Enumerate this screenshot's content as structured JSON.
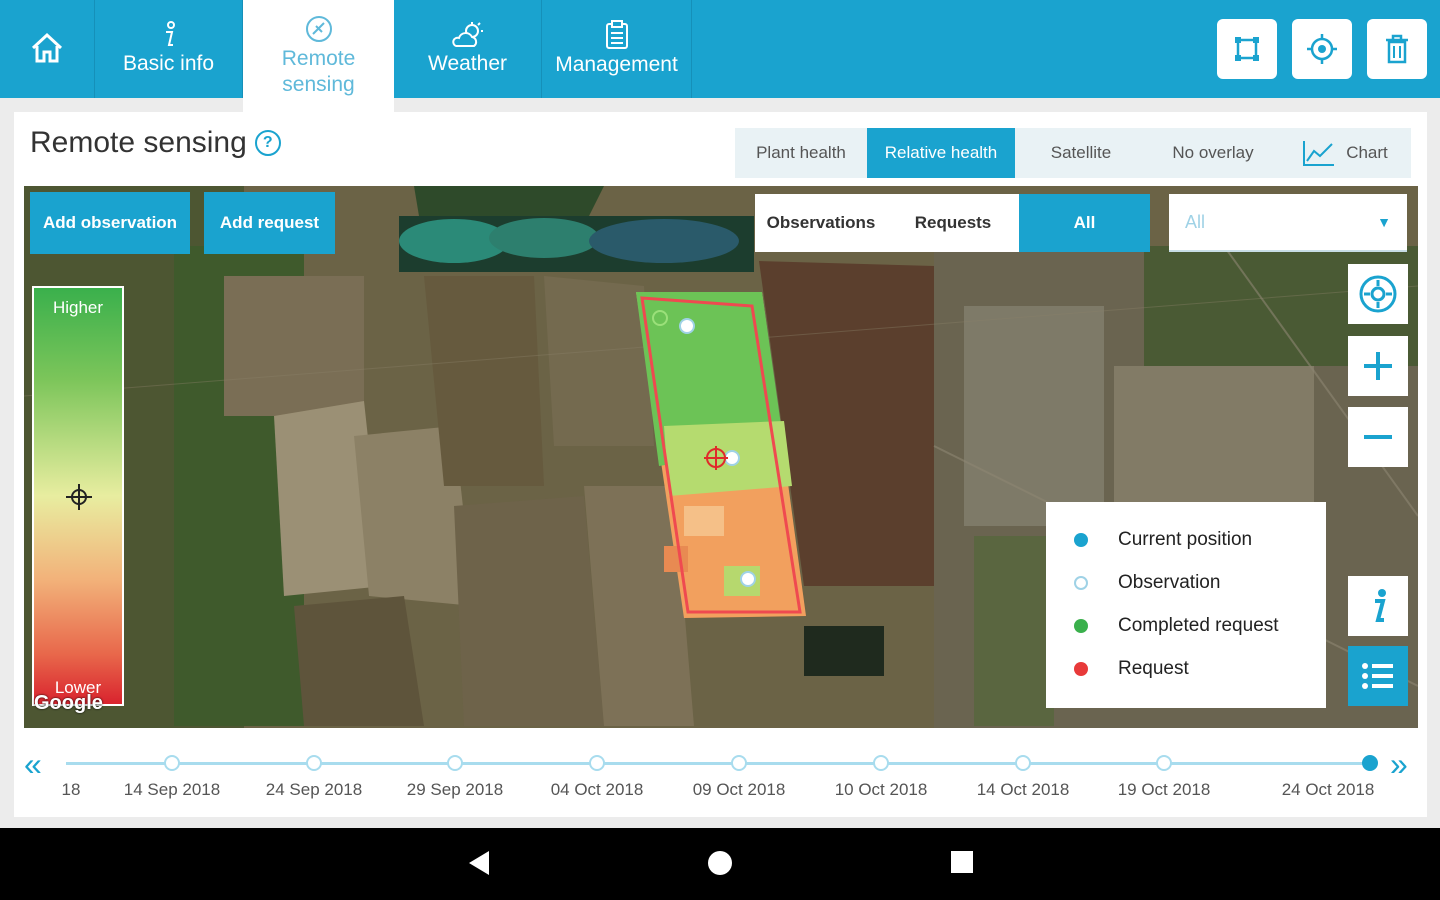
{
  "nav": {
    "tabs": [
      {
        "label": "Basic info",
        "icon": "info-icon"
      },
      {
        "label": "Remote\nsensing",
        "icon": "satellite-icon"
      },
      {
        "label": "Weather",
        "icon": "weather-icon"
      },
      {
        "label": "Management",
        "icon": "clipboard-icon"
      }
    ],
    "home_icon": "home-icon",
    "actions": [
      "draw-area-icon",
      "locate-icon",
      "delete-icon"
    ],
    "accent": "#1aa3cf"
  },
  "page": {
    "title": "Remote sensing",
    "help_symbol": "?"
  },
  "overlay_tabs": {
    "items": [
      "Plant health",
      "Relative health",
      "Satellite",
      "No overlay",
      "Chart"
    ],
    "active": "Relative health"
  },
  "map": {
    "add_observation": "Add observation",
    "add_request": "Add request",
    "filter_tabs": [
      "Observations",
      "Requests",
      "All"
    ],
    "filter_active": "All",
    "select_value": "All",
    "scale_high": "Higher",
    "scale_low": "Lower",
    "attribution": "Google",
    "legend": [
      {
        "label": "Current position",
        "color": "#1aa3cf"
      },
      {
        "label": "Observation",
        "color": "#ffffff"
      },
      {
        "label": "Completed request",
        "color": "#3ab04c"
      },
      {
        "label": "Request",
        "color": "#e83a3a"
      }
    ]
  },
  "timeline": {
    "dates": [
      "18",
      "14 Sep 2018",
      "24 Sep 2018",
      "29 Sep 2018",
      "04 Oct 2018",
      "09 Oct 2018",
      "10 Oct 2018",
      "14 Oct 2018",
      "19 Oct 2018",
      "24 Oct 2018"
    ],
    "selected": "24 Oct 2018"
  }
}
